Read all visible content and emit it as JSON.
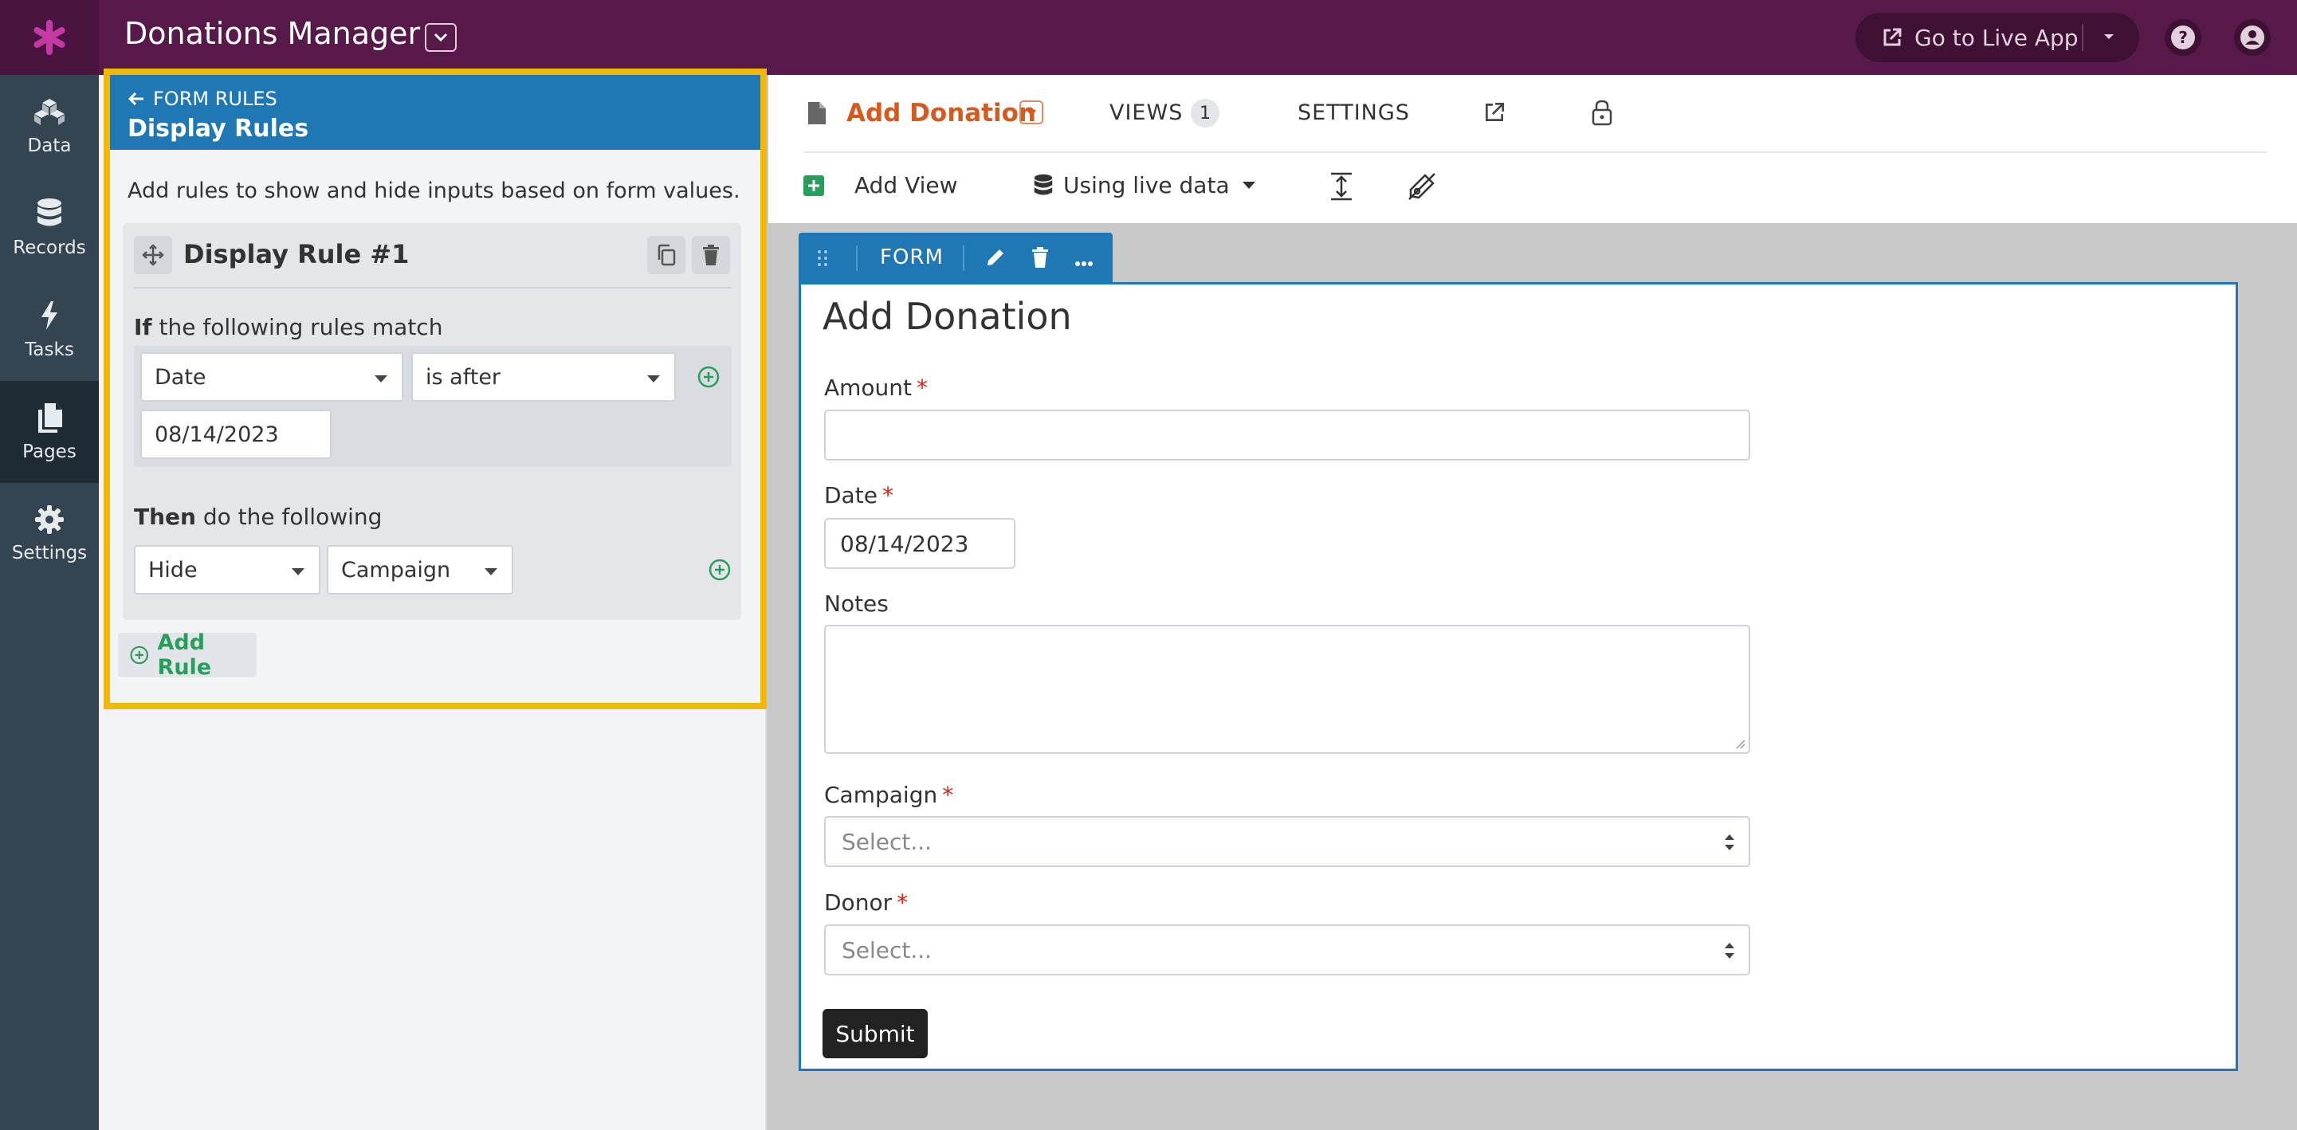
{
  "app": {
    "title": "Donations Manager",
    "live_app_label": "Go to Live App"
  },
  "nav": {
    "items": [
      {
        "label": "Data",
        "icon": "data-icon"
      },
      {
        "label": "Records",
        "icon": "database-icon"
      },
      {
        "label": "Tasks",
        "icon": "lightning-icon"
      },
      {
        "label": "Pages",
        "icon": "pages-icon",
        "active": true
      },
      {
        "label": "Settings",
        "icon": "gear-icon"
      }
    ]
  },
  "rules_panel": {
    "back_label": "FORM RULES",
    "title": "Display Rules",
    "description": "Add rules to show and hide inputs based on form values.",
    "rule": {
      "name": "Display Rule #1",
      "if_bold": "If",
      "if_rest": " the following rules match",
      "condition_field": "Date",
      "condition_operator": "is after",
      "condition_value": "08/14/2023",
      "then_bold": "Then",
      "then_rest": " do the following",
      "action": "Hide",
      "action_target": "Campaign"
    },
    "add_rule_label": "Add Rule"
  },
  "page": {
    "name": "Add Donation",
    "tabs": {
      "views": "VIEWS",
      "views_count": "1",
      "settings": "SETTINGS"
    },
    "add_view_label": "Add View",
    "data_source_label": "Using live data"
  },
  "form_view": {
    "toolbar_label": "FORM",
    "title": "Add Donation",
    "fields": {
      "amount": {
        "label": "Amount",
        "required": "*",
        "value": ""
      },
      "date": {
        "label": "Date",
        "required": "*",
        "value": "08/14/2023"
      },
      "notes": {
        "label": "Notes",
        "value": ""
      },
      "campaign": {
        "label": "Campaign",
        "required": "*",
        "placeholder": "Select..."
      },
      "donor": {
        "label": "Donor",
        "required": "*",
        "placeholder": "Select..."
      }
    },
    "submit_label": "Submit"
  },
  "colors": {
    "topbar": "#57184a",
    "nav": "#344450",
    "primary_blue": "#1f78b4",
    "highlight": "#f2b807",
    "page_accent": "#d45a1e",
    "add_green": "#2a9d5a"
  }
}
